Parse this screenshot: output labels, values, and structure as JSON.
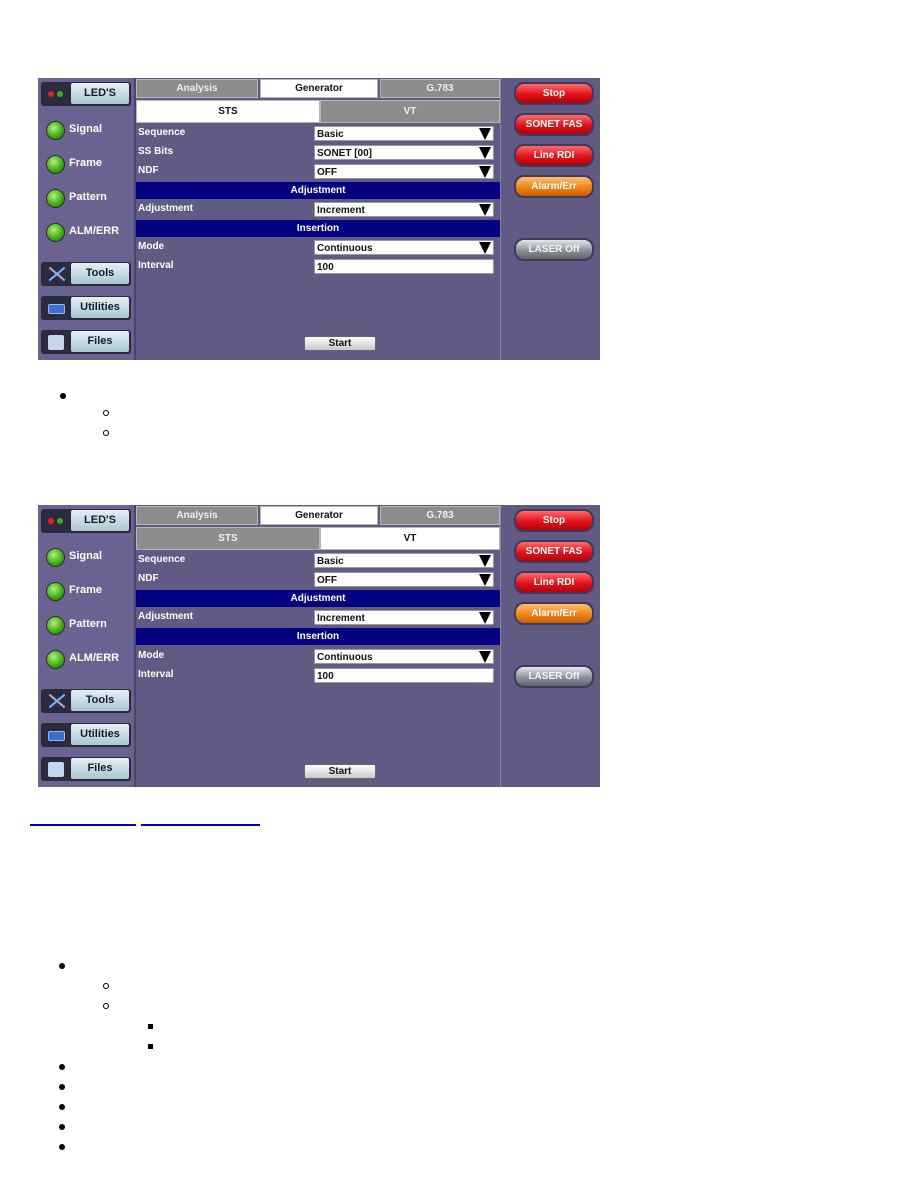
{
  "screens": [
    {
      "left_nav": {
        "leds_label": "LED'S",
        "leds": [
          "Signal",
          "Frame",
          "Pattern",
          "ALM/ERR"
        ],
        "tools_label": "Tools",
        "utilities_label": "Utilities",
        "files_label": "Files"
      },
      "tabs": [
        "Analysis",
        "Generator",
        "G.783"
      ],
      "active_tab": "Generator",
      "subtabs": [
        "STS",
        "VT"
      ],
      "active_subtab": "STS",
      "fields": {
        "sequence": {
          "label": "Sequence",
          "value": "Basic"
        },
        "ss_bits": {
          "label": "SS Bits",
          "value": "SONET [00]"
        },
        "ndf": {
          "label": "NDF",
          "value": "OFF"
        },
        "adjustment_header": "Adjustment",
        "adjustment": {
          "label": "Adjustment",
          "value": "Increment"
        },
        "insertion_header": "Insertion",
        "mode": {
          "label": "Mode",
          "value": "Continuous"
        },
        "interval": {
          "label": "Interval",
          "value": "100"
        }
      },
      "start_label": "Start",
      "right_buttons": {
        "stop": "Stop",
        "sonet_fas": "SONET FAS",
        "line_rdi": "Line RDI",
        "alarm_err": "Alarm/Err",
        "laser": "LASER Off"
      }
    },
    {
      "left_nav": {
        "leds_label": "LED'S",
        "leds": [
          "Signal",
          "Frame",
          "Pattern",
          "ALM/ERR"
        ],
        "tools_label": "Tools",
        "utilities_label": "Utilities",
        "files_label": "Files"
      },
      "tabs": [
        "Analysis",
        "Generator",
        "G.783"
      ],
      "active_tab": "Generator",
      "subtabs": [
        "STS",
        "VT"
      ],
      "active_subtab": "VT",
      "fields": {
        "sequence": {
          "label": "Sequence",
          "value": "Basic"
        },
        "ndf": {
          "label": "NDF",
          "value": "OFF"
        },
        "adjustment_header": "Adjustment",
        "adjustment": {
          "label": "Adjustment",
          "value": "Increment"
        },
        "insertion_header": "Insertion",
        "mode": {
          "label": "Mode",
          "value": "Continuous"
        },
        "interval": {
          "label": "Interval",
          "value": "100"
        }
      },
      "start_label": "Start",
      "right_buttons": {
        "stop": "Stop",
        "sonet_fas": "SONET FAS",
        "line_rdi": "Line RDI",
        "alarm_err": "Alarm/Err",
        "laser": "LASER Off"
      }
    }
  ],
  "colors": {
    "panel_bg": "#615a84",
    "section_header": "#030382",
    "alarm_red": "#e0121a",
    "alarm_orange": "#f08418",
    "led_green": "#3fae16",
    "link_blue": "#0000cc"
  }
}
